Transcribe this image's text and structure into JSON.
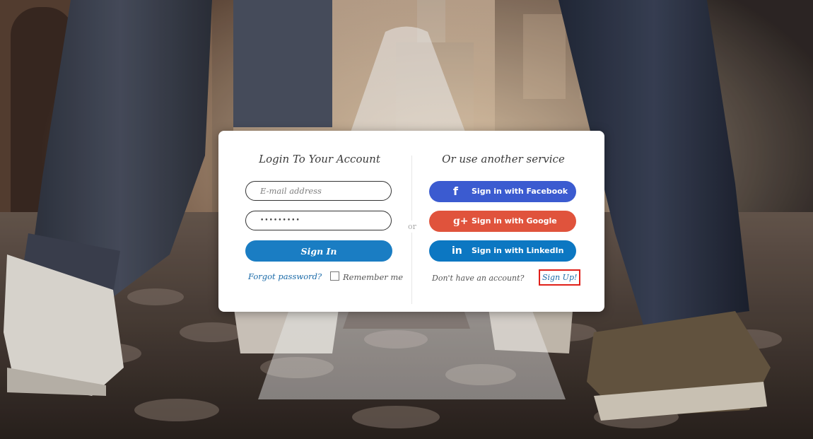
{
  "login": {
    "title": "Login To Your Account",
    "email_placeholder": "E-mail address",
    "password_value": "•••••••••",
    "sign_in_label": "Sign In",
    "forgot_password_label": "Forgot password?",
    "remember_me_label": "Remember me"
  },
  "divider": {
    "or_label": "or"
  },
  "social": {
    "title": "Or use another service",
    "facebook": {
      "icon": "f",
      "label": "Sign in with Facebook",
      "icon_name": "facebook-icon"
    },
    "google": {
      "icon": "g+",
      "label": "Sign in with Google",
      "icon_name": "google-plus-icon"
    },
    "linkedin": {
      "icon": "in",
      "label": "Sign in with LinkedIn",
      "icon_name": "linkedin-icon"
    }
  },
  "signup": {
    "prompt": "Don't have an account?",
    "link_label": "Sign Up!"
  },
  "colors": {
    "sign_in_blue": "#1a7dc3",
    "facebook": "#3b5bd0",
    "google": "#e0533c",
    "linkedin": "#0c77c2",
    "highlight_box": "#e0201a",
    "link": "#1a6aa8"
  }
}
